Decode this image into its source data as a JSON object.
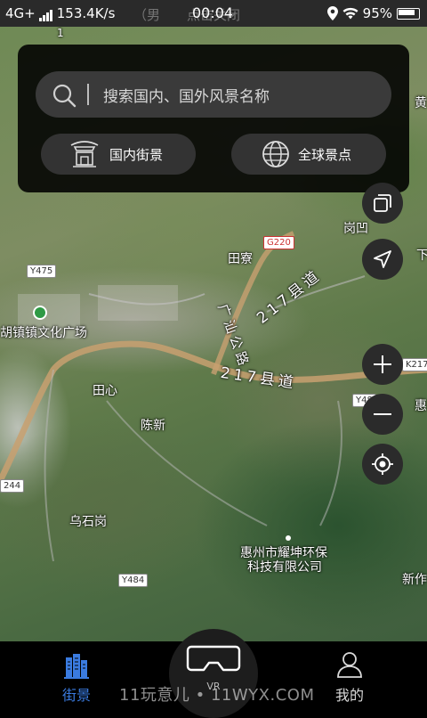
{
  "status_bar": {
    "network": "4G+",
    "speed": "153.4K/s",
    "notification_hint": "（男　　点击关闭",
    "time": "00:04",
    "battery": "95%"
  },
  "search": {
    "placeholder": "搜索国内、国外风景名称",
    "domestic_label": "国内街景",
    "global_label": "全球景点"
  },
  "map": {
    "places": {
      "tianliao": "田寮",
      "gangwei": "岗凹",
      "culture_square": "胡镇镇文化广场",
      "tianxin": "田心",
      "chenxin": "陈新",
      "wushigang": "乌石岗",
      "company_line1": "惠州市耀坤环保",
      "company_line2": "科技有限公司",
      "xinzuo": "新作",
      "hui": "惠",
      "xia": "下",
      "huang": "黄"
    },
    "roads": {
      "g220": "G220",
      "y475": "Y475",
      "k217": "K217",
      "y48": "Y48",
      "s244": "244",
      "y484": "Y484",
      "road_217_upper": "217县道",
      "road_217_lower": "217县道",
      "guangshan": "广汕公路",
      "edge_num": "1"
    }
  },
  "bottom_nav": {
    "street_label": "街景",
    "vr_label": "VR",
    "mine_label": "我的"
  },
  "watermark": "11玩意儿 • 11WYX.COM",
  "colors": {
    "accent": "#3a7be0",
    "panel_bg": "#000000",
    "pill_bg": "#333333",
    "button_bg": "#2b2b2b"
  }
}
